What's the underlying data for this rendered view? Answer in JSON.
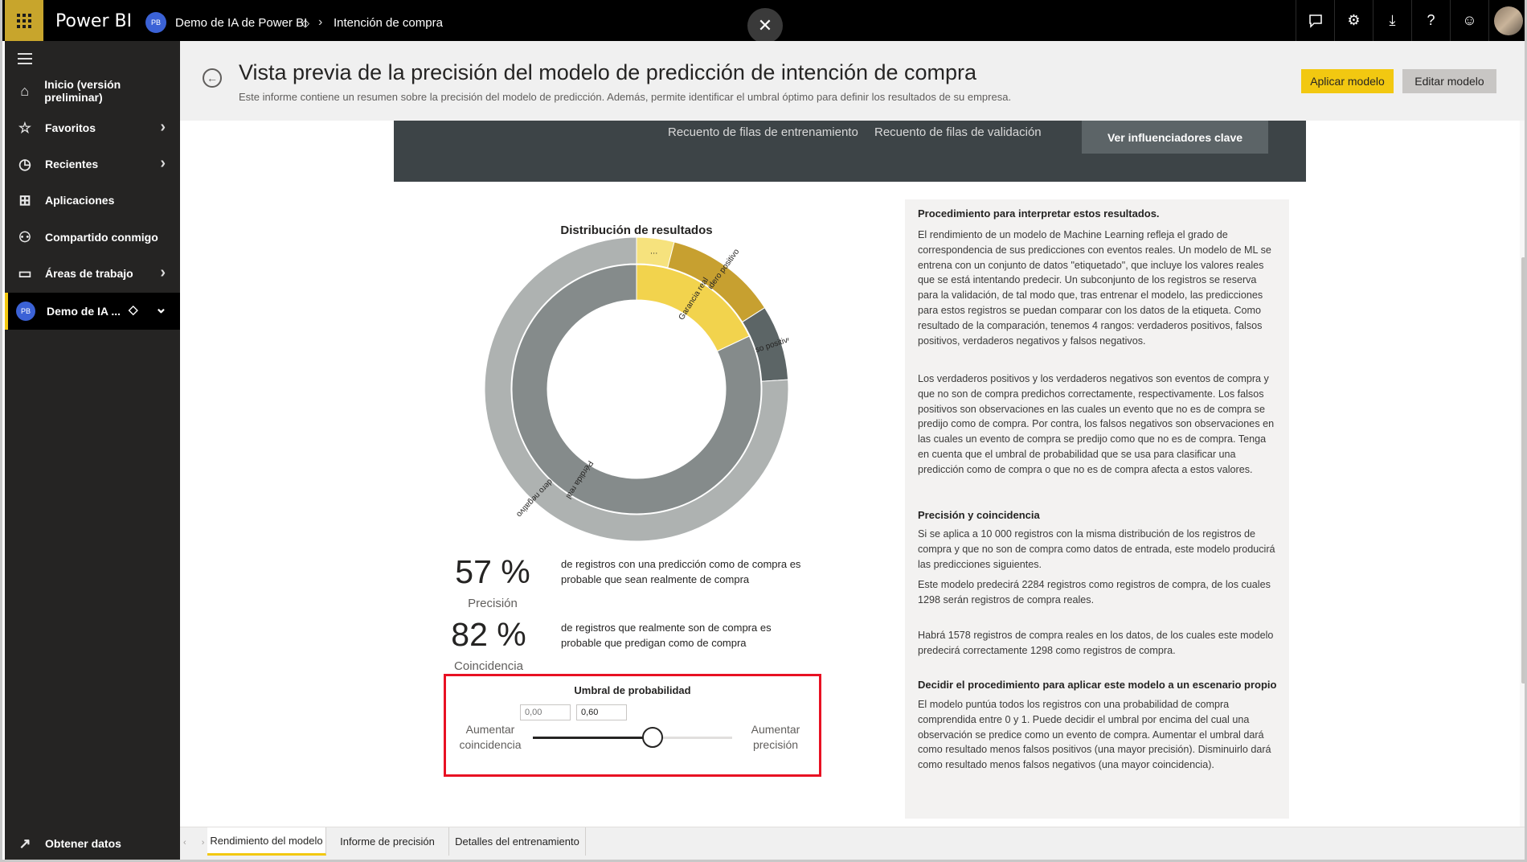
{
  "app": {
    "brand": "Power BI",
    "workspace_initials": "PB",
    "breadcrumb": {
      "workspace": "Demo de IA de Power BI",
      "report": "Intención de compra"
    }
  },
  "nav": {
    "items": [
      {
        "label": "Inicio (versión preliminar)",
        "icon": "home-icon"
      },
      {
        "label": "Favoritos",
        "icon": "star-icon"
      },
      {
        "label": "Recientes",
        "icon": "clock-icon"
      },
      {
        "label": "Aplicaciones",
        "icon": "apps-icon"
      },
      {
        "label": "Compartido conmigo",
        "icon": "shared-icon"
      },
      {
        "label": "Áreas de trabajo",
        "icon": "workspaces-icon"
      }
    ],
    "current_workspace": {
      "label": "Demo de IA ...",
      "initials": "PB"
    },
    "get_data": "Obtener datos"
  },
  "header": {
    "title": "Vista previa de la precisión del modelo de predicción de intención de compra",
    "subtitle": "Este informe contiene un resumen sobre la precisión del modelo de predicción. Además, permite identificar el umbral óptimo para definir los resultados de su empresa.",
    "apply_label": "Aplicar modelo",
    "edit_label": "Editar modelo"
  },
  "band": {
    "training_rows": "Recuento de filas de entrenamiento",
    "validation_rows": "Recuento de filas de validación",
    "key_influencers": "Ver influenciadores clave"
  },
  "chart_data": {
    "type": "pie",
    "title": "Distribución de resultados",
    "inner_ring": [
      {
        "label": "Garancia real",
        "value": 18,
        "color": "#f2d34d"
      },
      {
        "label": "Pérdida real",
        "value": 82,
        "color": "#858b8b"
      }
    ],
    "outer_ring": [
      {
        "label": "…",
        "value": 4,
        "color": "#f6e27d"
      },
      {
        "label": "Verdadero positivo",
        "value": 12,
        "color": "#c7a030"
      },
      {
        "label": "Falso positivo",
        "value": 8,
        "color": "#5c6566"
      },
      {
        "label": "Verdadero negativo",
        "value": 76,
        "color": "#aeb2b1"
      }
    ]
  },
  "metrics": {
    "precision": {
      "value": "57 %",
      "label": "Precisión",
      "desc": "de registros con una predicción como de compra es probable que sean realmente de compra"
    },
    "recall": {
      "value": "82 %",
      "label": "Coincidencia",
      "desc": "de registros que realmente son de compra es probable que predigan como de compra"
    }
  },
  "threshold": {
    "title": "Umbral de probabilidad",
    "min_placeholder": "0,00",
    "value_text": "0,60",
    "value": 0.6,
    "left_label": "Aumentar coincidencia",
    "right_label": "Aumentar precisión"
  },
  "info": {
    "h1": "Procedimiento para interpretar estos resultados.",
    "p1": "El rendimiento de un modelo de Machine Learning refleja el grado de correspondencia de sus predicciones con eventos reales.  Un modelo de ML se entrena con un conjunto de datos \"etiquetado\", que incluye los valores reales que se está intentando predecir.  Un subconjunto de los registros se reserva para la validación, de tal modo que, tras entrenar el modelo, las predicciones para estos registros se puedan comparar con los datos de la etiqueta.  Como resultado de la comparación, tenemos 4 rangos:  verdaderos positivos, falsos positivos, verdaderos negativos y falsos negativos.",
    "p2": "Los verdaderos positivos y los verdaderos negativos son eventos de compra y que no son de compra predichos correctamente, respectivamente.  Los falsos positivos son observaciones en las cuales un evento que no es de compra se predijo como de compra.  Por contra, los falsos negativos son observaciones en las cuales un evento de compra se predijo como que no es de compra.  Tenga en cuenta que el umbral de probabilidad que se usa para clasificar una predicción como de compra o que no es de compra afecta a estos valores.",
    "h2": "Precisión y coincidencia",
    "p3": "Si se aplica a 10 000 registros con la misma distribución de los registros de compra y que no son de compra como datos de entrada, este modelo producirá las predicciones siguientes.",
    "p4": "Este modelo predecirá 2284 registros como registros de compra, de los cuales 1298 serán registros de compra reales.",
    "p5": "Habrá 1578 registros de compra reales en los datos, de los cuales este modelo predecirá correctamente 1298 como registros de compra.",
    "h3": "Decidir el procedimiento para aplicar este modelo a un escenario propio",
    "p6": "El modelo puntúa todos los registros con una probabilidad de compra comprendida entre 0 y 1.  Puede decidir el umbral por encima del cual una observación se predice como un evento de compra. Aumentar el umbral dará como resultado menos falsos positivos (una mayor precisión). Disminuirlo dará como resultado menos falsos negativos (una mayor coincidencia)."
  },
  "tabs": [
    "Rendimiento del modelo",
    "Informe de precisión",
    "Detalles del entrenamiento"
  ]
}
